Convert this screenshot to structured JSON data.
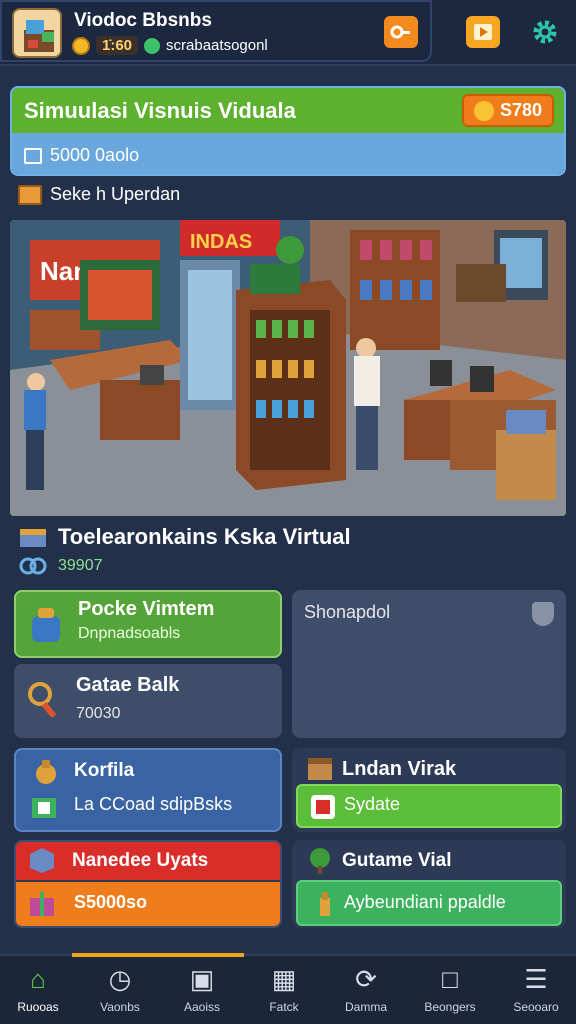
{
  "header": {
    "title": "Viodoc Bbsnbs",
    "coins": "1̇:60",
    "secondary": "scrabaatsogonl"
  },
  "sim_panel": {
    "title": "Simuulasi Visnuis Viduala",
    "subtitle": "5000 0aolo",
    "price": "S780"
  },
  "section_label": "Seke h Uperdan",
  "store": {
    "title": "Toelearonkains Kska Virtual",
    "value": "39907"
  },
  "cards": {
    "pocket": {
      "title": "Pocke Vimtem",
      "subtitle": "Dnpnadsoabls"
    },
    "gatae": {
      "title": "Gatae Balk",
      "value": "70030"
    },
    "shop": {
      "title": "Shonapdol"
    },
    "korfia": {
      "title": "Korfila",
      "subtitle": "La CCoad sdipBsks"
    },
    "lndan": {
      "title": "Lndan Virak",
      "bar_label": "Sydate"
    },
    "nanedee": {
      "title": "Nanedee Uyats",
      "bar_label": "S5000so"
    },
    "gutame": {
      "title": "Gutame Vial",
      "bar_label": "Aybeundiani ppaldle"
    }
  },
  "nav": [
    {
      "label": "Ruooas",
      "icon": "home-icon"
    },
    {
      "label": "Vaonbs",
      "icon": "clock-icon"
    },
    {
      "label": "Aaoiss",
      "icon": "box-icon"
    },
    {
      "label": "Fatck",
      "icon": "factory-icon"
    },
    {
      "label": "Damma",
      "icon": "refresh-icon"
    },
    {
      "label": "Beongers",
      "icon": "building-icon"
    },
    {
      "label": "Seooaro",
      "icon": "menu-icon"
    }
  ]
}
